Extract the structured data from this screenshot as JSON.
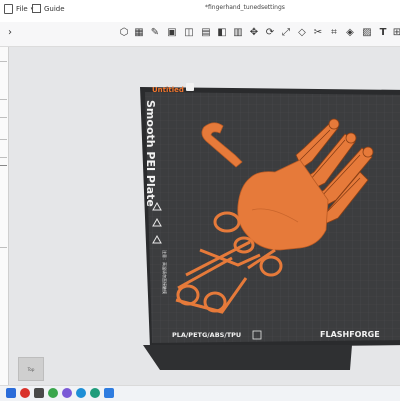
{
  "window": {
    "title": "*fingerhand_tunedsettings"
  },
  "menu": {
    "file_label": "File",
    "guide_label": "Guide"
  },
  "bed": {
    "plate_name": "Untitled",
    "plate_type": "Smooth PEI Plate",
    "materials": "PLA/PETG/ABS/TPU",
    "brand": "FLASHFORGE",
    "warning_text": "注意：高温请勿直接触摸"
  },
  "viewcube": {
    "label": "Top"
  },
  "colors": {
    "bed": "#3c3d3f",
    "model": "#e67a3a",
    "model_dark": "#b95a24",
    "accent": "#f2762e"
  },
  "toolbar_icons": [
    "cube-icon",
    "grid-icon",
    "paint-icon",
    "image-icon",
    "split-icon",
    "layers-icon",
    "move-icon",
    "rotate-icon",
    "scale-icon",
    "cut-icon",
    "support-icon",
    "seam-icon",
    "text-icon",
    "measure-icon"
  ]
}
